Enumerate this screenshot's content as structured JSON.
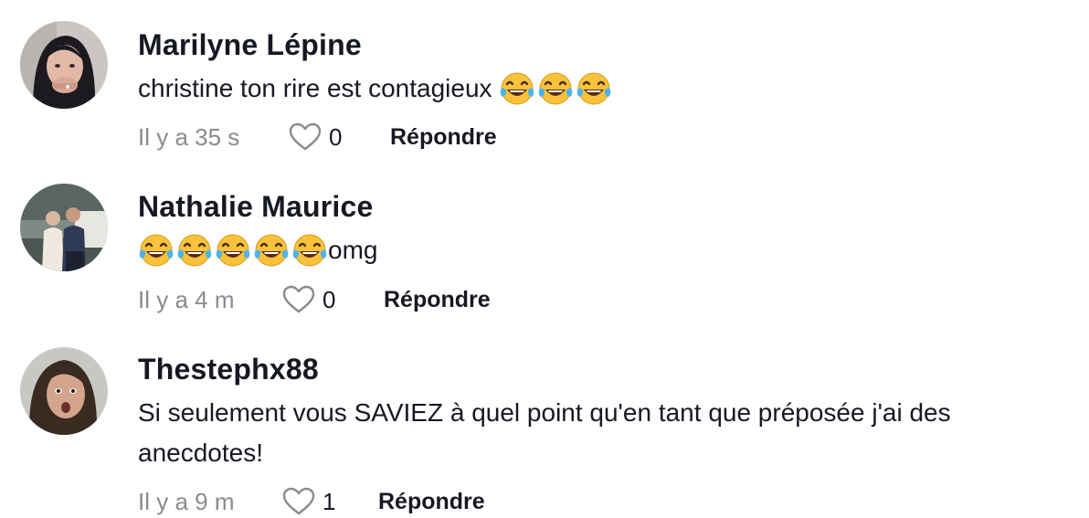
{
  "comments": [
    {
      "author": "Marilyne Lépine",
      "text_before": "christine ton rire est contagieux ",
      "text_after": "",
      "emoji_count": 3,
      "emoji": "face-with-tears-of-joy",
      "time": "Il y a 35 s",
      "likes": "0",
      "reply_label": "Répondre"
    },
    {
      "author": "Nathalie Maurice",
      "text_before": "",
      "text_after": "omg",
      "emoji_count": 5,
      "emoji": "face-with-tears-of-joy",
      "time": "Il y a 4 m",
      "likes": "0",
      "reply_label": "Répondre"
    },
    {
      "author": "Thestephx88",
      "text_line1": "Si seulement vous SAVIEZ à quel point qu'en tant que préposée j'ai des",
      "text_line2": "anecdotes!",
      "time": "Il y a 9 m",
      "likes": "1",
      "reply_label": "Répondre"
    }
  ],
  "icons": {
    "like": "heart-outline-icon",
    "emoji": "face-with-tears-of-joy-emoji"
  },
  "colors": {
    "text": "#161823",
    "muted": "#8a8b91",
    "heart_stroke": "#8a8b91",
    "emoji_face": "#f9c23c",
    "emoji_tears": "#4fb3e8"
  }
}
